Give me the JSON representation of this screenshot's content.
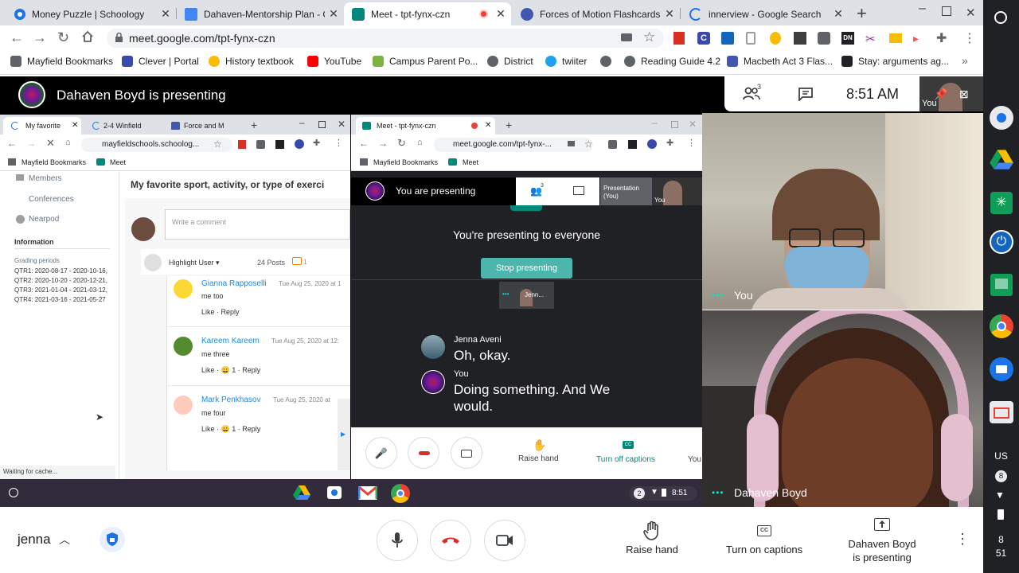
{
  "tabs": [
    {
      "title": "Money Puzzle | Schoology",
      "favicon_color": "#1a73e8"
    },
    {
      "title": "Dahaven-Mentorship Plan - Go",
      "favicon_color": "#4285f4"
    },
    {
      "title": "Meet - tpt-fynx-czn",
      "favicon_color": "#00897b"
    },
    {
      "title": "Forces of Motion Flashcards |",
      "favicon_color": "#4257b2"
    },
    {
      "title": "innerview - Google Search",
      "favicon_color": "#1a73e8"
    }
  ],
  "address": {
    "url": "meet.google.com/tpt-fynx-czn"
  },
  "bookmarks": [
    {
      "label": "Mayfield Bookmarks"
    },
    {
      "label": "Clever | Portal"
    },
    {
      "label": "History textbook"
    },
    {
      "label": "YouTube"
    },
    {
      "label": "Campus Parent Po..."
    },
    {
      "label": "District"
    },
    {
      "label": "twiiter"
    },
    {
      "label": ""
    },
    {
      "label": "Reading Guide 4.2"
    },
    {
      "label": "Macbeth Act 3 Flas..."
    },
    {
      "label": "Stay: arguments ag..."
    }
  ],
  "meet": {
    "presenting_banner": "Dahaven Boyd is presenting",
    "participants_count": "3",
    "time": "8:51 AM",
    "self_tile_label": "You",
    "tile_you": "You",
    "tile_dahaven": "Dahaven Boyd",
    "bottom": {
      "user_name": "jenna",
      "raise_hand": "Raise hand",
      "captions": "Turn on captions",
      "presenting_line1": "Dahaven Boyd",
      "presenting_line2": "is presenting"
    }
  },
  "shared_screen": {
    "left_window": {
      "tabs": [
        "My favorite",
        "2-4 Winfield",
        "Force and M"
      ],
      "url": "mayfieldschools.schoolog...",
      "bookmarks": [
        "Mayfield Bookmarks",
        "Meet"
      ],
      "sidebar": {
        "items": [
          "Members",
          "Conferences",
          "Nearpod"
        ],
        "info_heading": "Information",
        "grading_label": "Grading periods",
        "grading_text": "QTR1: 2020-08-17 - 2020-10-16, QTR2: 2020-10-20 - 2020-12-21, QTR3: 2021-01-04 - 2021-03-12, QTR4: 2021-03-16 - 2021-05-27"
      },
      "post_title": "My favorite sport, activity, or type of exerci",
      "comment_placeholder": "Write a comment",
      "highlight_user": "Highlight User",
      "posts_count": "24 Posts",
      "comment_icon_count": "1",
      "comments": [
        {
          "name": "Gianna Rapposelli",
          "date": "Tue Aug 25, 2020 at 1",
          "text": "me too",
          "actions": "Like · Reply"
        },
        {
          "name": "Kareem Kareem",
          "date": "Tue Aug 25, 2020 at 12:",
          "text": "me three",
          "actions": "Like · 😀 1 · Reply"
        },
        {
          "name": "Mark Penkhasov",
          "date": "Tue Aug 25, 2020 at",
          "text": "me four",
          "actions": "Like · 😀 1 · Reply"
        }
      ],
      "status": "Waiting for cache..."
    },
    "right_window": {
      "tab": "Meet - tpt-fynx-czn",
      "url": "meet.google.com/tpt-fynx-...",
      "bookmarks": [
        "Mayfield Bookmarks",
        "Meet"
      ],
      "you_are_presenting": "You are presenting",
      "participants_count": "3",
      "presentation_label": "Presentation\n(You)",
      "you_label": "You",
      "presenting_to_everyone": "You're presenting to everyone",
      "stop_presenting": "Stop presenting",
      "thumb_label": "Jenn...",
      "captions": [
        {
          "speaker": "Jenna Aveni",
          "text": "Oh, okay."
        },
        {
          "speaker": "You",
          "text": "Doing something. And We would."
        }
      ],
      "raise_hand": "Raise hand",
      "turn_off_captions": "Turn off captions",
      "you_cut": "You"
    },
    "shelf": {
      "time": "8:51",
      "badge": "2"
    }
  },
  "chromeos_shelf": {
    "locale": "US",
    "badge": "8",
    "time_hour": "8",
    "time_min": "51"
  },
  "colors": {
    "meet_green": "#00897b",
    "stop_btn": "#4db6ac",
    "red": "#ea4335"
  }
}
